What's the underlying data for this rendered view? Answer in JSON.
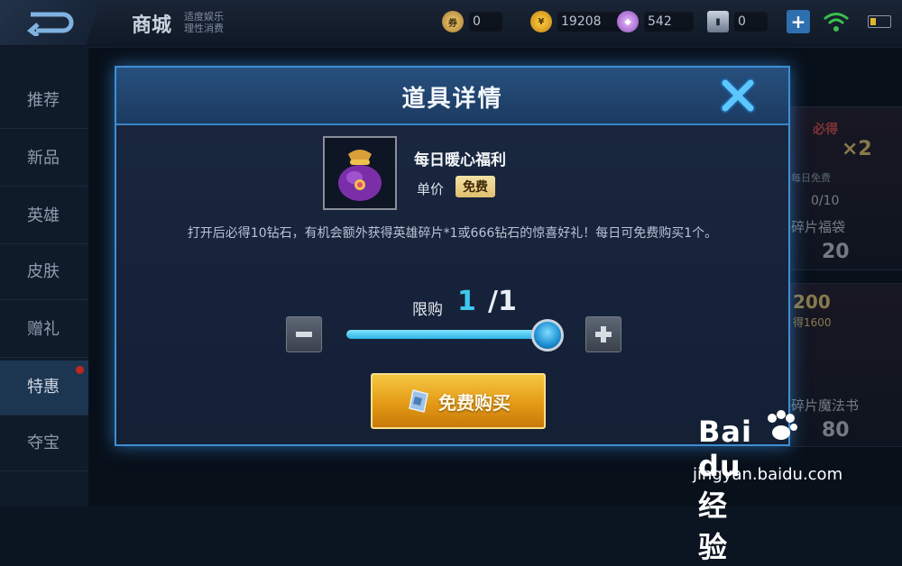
{
  "header": {
    "shop_title": "商城",
    "shop_sub_line1": "适度娱乐",
    "shop_sub_line2": "理性消费",
    "currencies": [
      {
        "icon": "voucher-icon",
        "value": "0"
      },
      {
        "icon": "gold-coin-icon",
        "value": "19208"
      },
      {
        "icon": "diamond-icon",
        "value": "542"
      },
      {
        "icon": "crystal-icon",
        "value": "0"
      }
    ],
    "plus_label": "+"
  },
  "sidebar": {
    "items": [
      {
        "label": "推荐"
      },
      {
        "label": "新品"
      },
      {
        "label": "英雄"
      },
      {
        "label": "皮肤"
      },
      {
        "label": "赠礼"
      },
      {
        "label": "特惠"
      },
      {
        "label": "夺宝"
      }
    ],
    "active_index": 5
  },
  "background_cards": {
    "card1_top": "必得",
    "card1_mult": "×2",
    "card1_free": "每日免费",
    "card1_progress": "0/10",
    "card1_name": "碎片福袋",
    "card1_price": "20",
    "card2_price": "200",
    "card2_sub": "得1600",
    "card2_name": "碎片魔法书",
    "card2_price_bottom": "80"
  },
  "modal": {
    "title": "道具详情",
    "item_icon": "purple-gift-bag-icon",
    "item_name": "每日暖心福利",
    "price_label": "单价",
    "price_value": "免费",
    "description": "打开后必得10钻石，有机会额外获得英雄碎片*1或666钻石的惊喜好礼！每日可免费购买1个。",
    "limit_label": "限购",
    "limit_current": "1",
    "limit_total": "/1",
    "quantity_fraction": 1.0,
    "buy_label": "免费购买"
  },
  "watermark": {
    "brand": "Bai du 经验",
    "url": "jingyan.baidu.com"
  },
  "colors": {
    "accent_blue": "#3fc8ef",
    "button_gold": "#e49a15",
    "price_badge": "#e0bf6e"
  }
}
